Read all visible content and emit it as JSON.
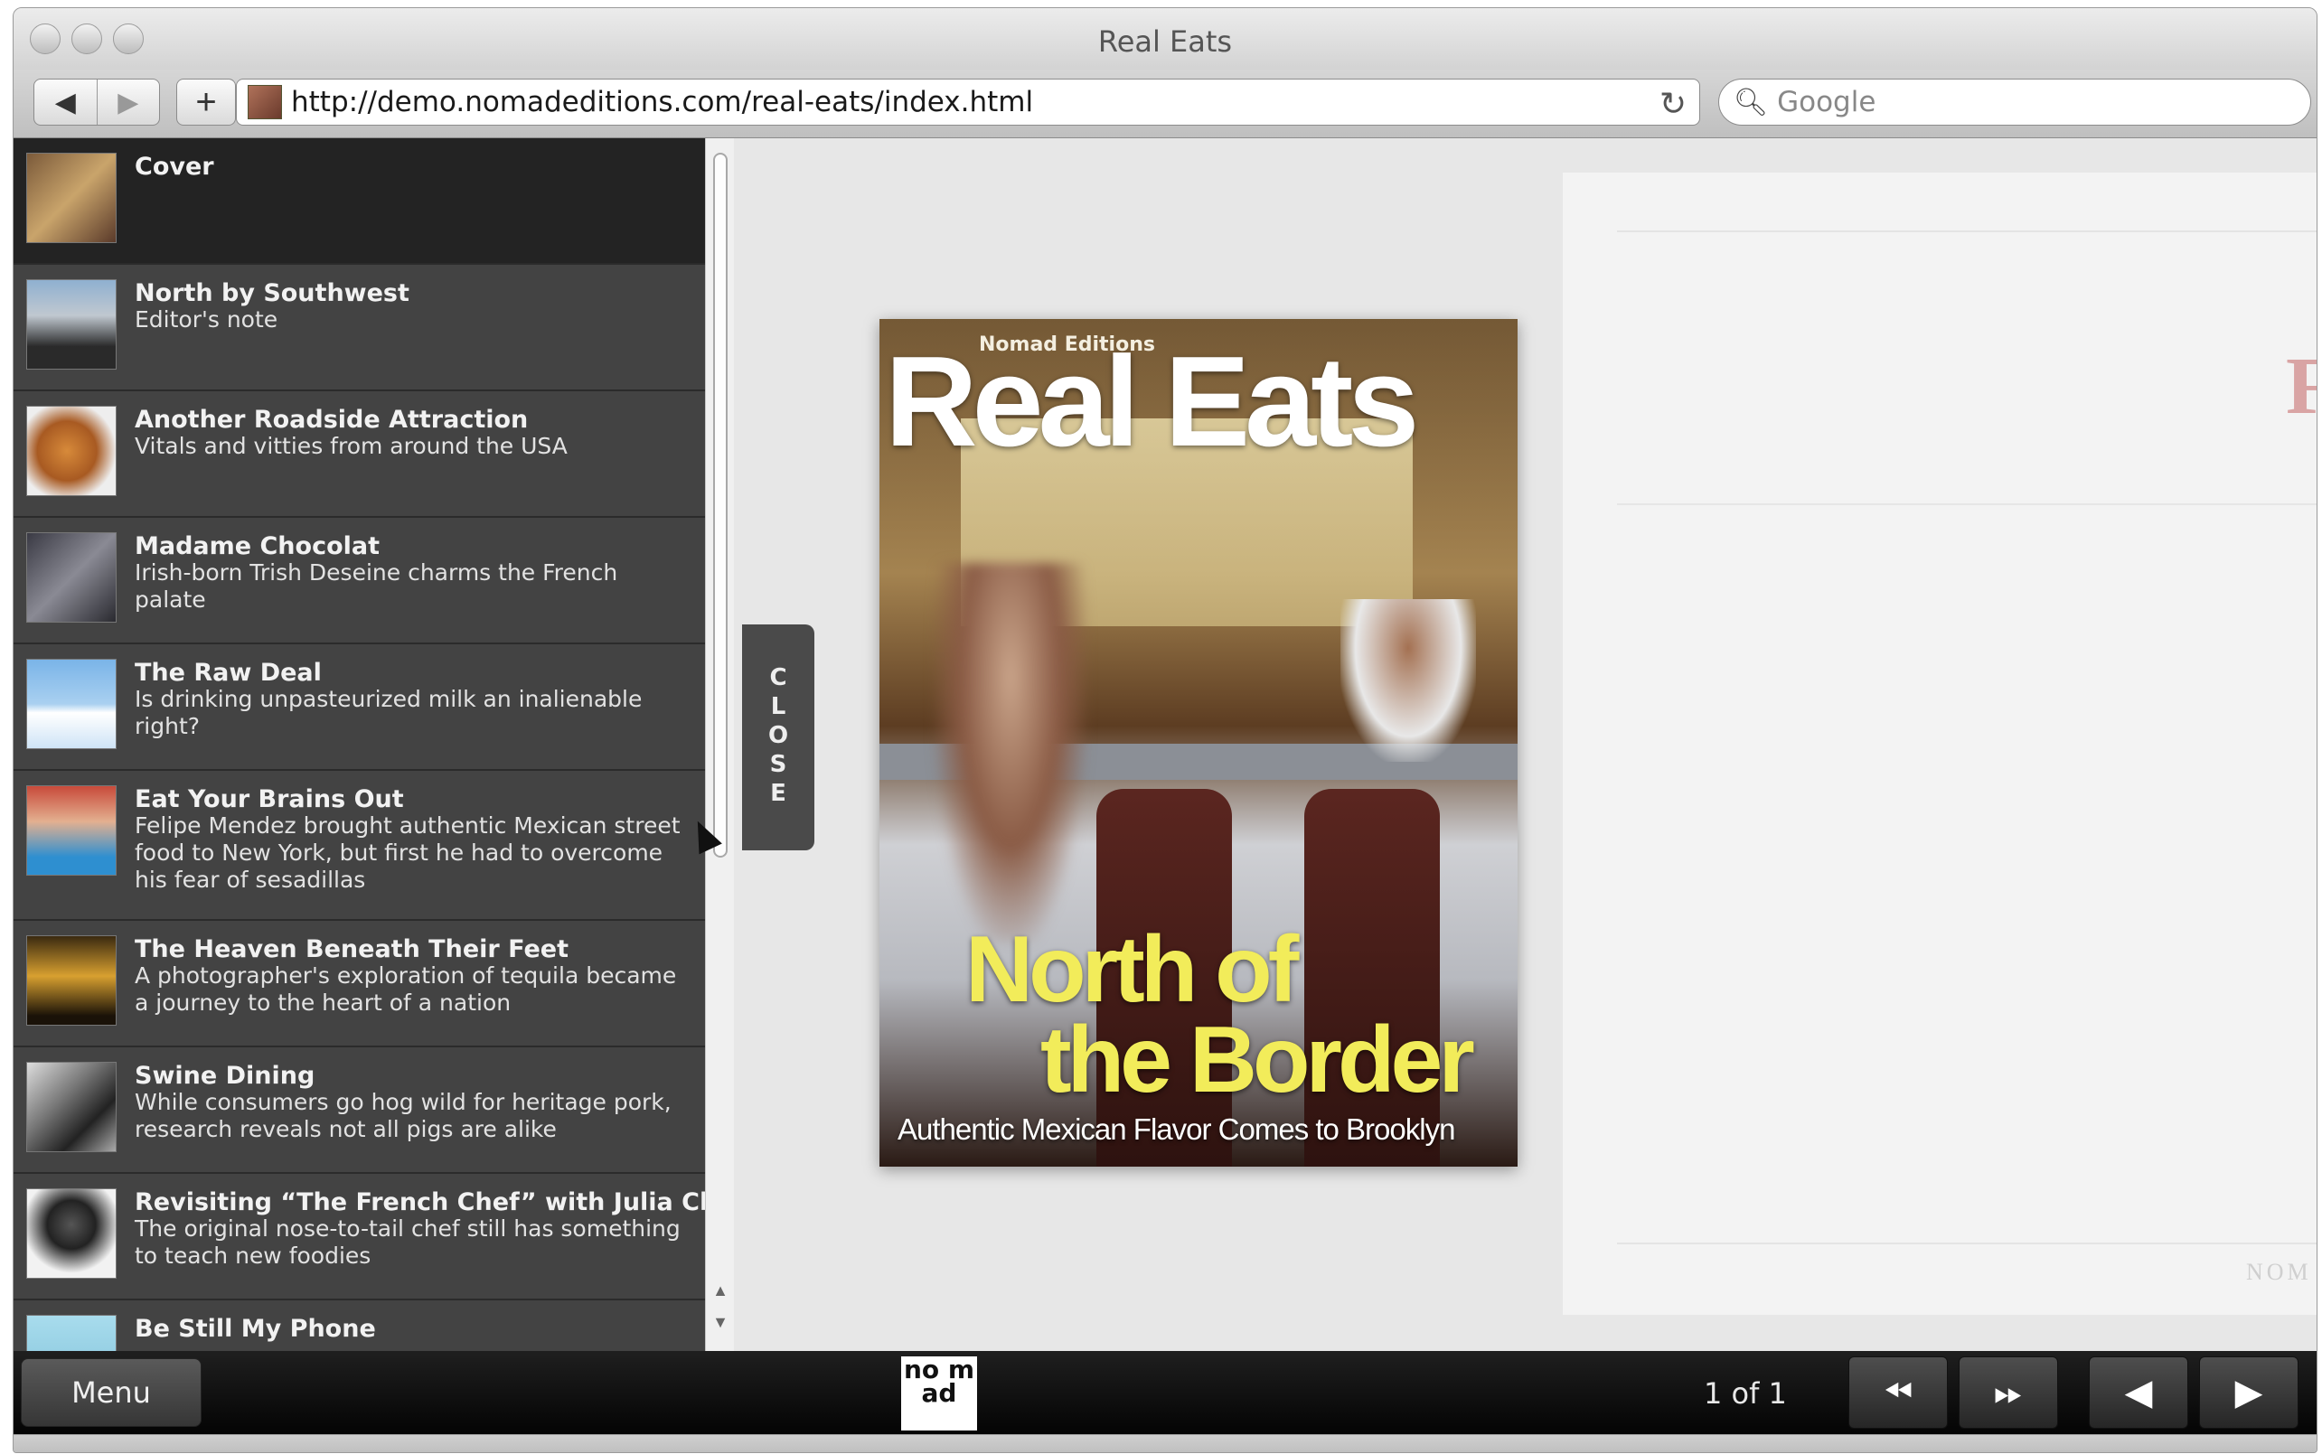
{
  "window": {
    "title": "Real Eats"
  },
  "toolbar": {
    "back_icon": "back-arrow-icon",
    "forward_icon": "forward-arrow-icon",
    "url": "http://demo.nomadeditions.com/real-eats/index.html",
    "search_placeholder": "Google"
  },
  "sidebar": {
    "items": [
      {
        "title": "Cover",
        "desc": ""
      },
      {
        "title": "North by Southwest",
        "desc": "Editor's note"
      },
      {
        "title": "Another Roadside Attraction",
        "desc": "Vitals and vitties from around the USA"
      },
      {
        "title": "Madame Chocolat",
        "desc": "Irish-born Trish Deseine charms the French palate"
      },
      {
        "title": "The Raw Deal",
        "desc": "Is drinking unpasteurized milk an inalienable right?"
      },
      {
        "title": "Eat Your Brains Out",
        "desc": "Felipe Mendez brought authentic Mexican street food to New York, but first he had to overcome his fear of sesadillas"
      },
      {
        "title": "The Heaven Beneath Their Feet",
        "desc": "A photographer's exploration of tequila became a journey to the heart of a nation"
      },
      {
        "title": "Swine Dining",
        "desc": "While consumers go hog wild for heritage pork, research reveals not all pigs are alike"
      },
      {
        "title": "Revisiting “The French Chef” with Julia Child",
        "desc": "The original nose-to-tail chef still has something to teach new foodies"
      },
      {
        "title": "Be Still My Phone",
        "desc": ""
      }
    ],
    "close_label": "CLOSE"
  },
  "cover": {
    "brand": "Nomad Editions",
    "title": "Real Eats",
    "headline1": "North of",
    "headline2": "the Border",
    "subhead": "Authentic Mexican Flavor Comes to Brooklyn"
  },
  "ghost": {
    "letter": "F",
    "footer": "NOM"
  },
  "bottombar": {
    "menu_label": "Menu",
    "logo_text": "no m ad",
    "page_count": "1 of 1"
  }
}
